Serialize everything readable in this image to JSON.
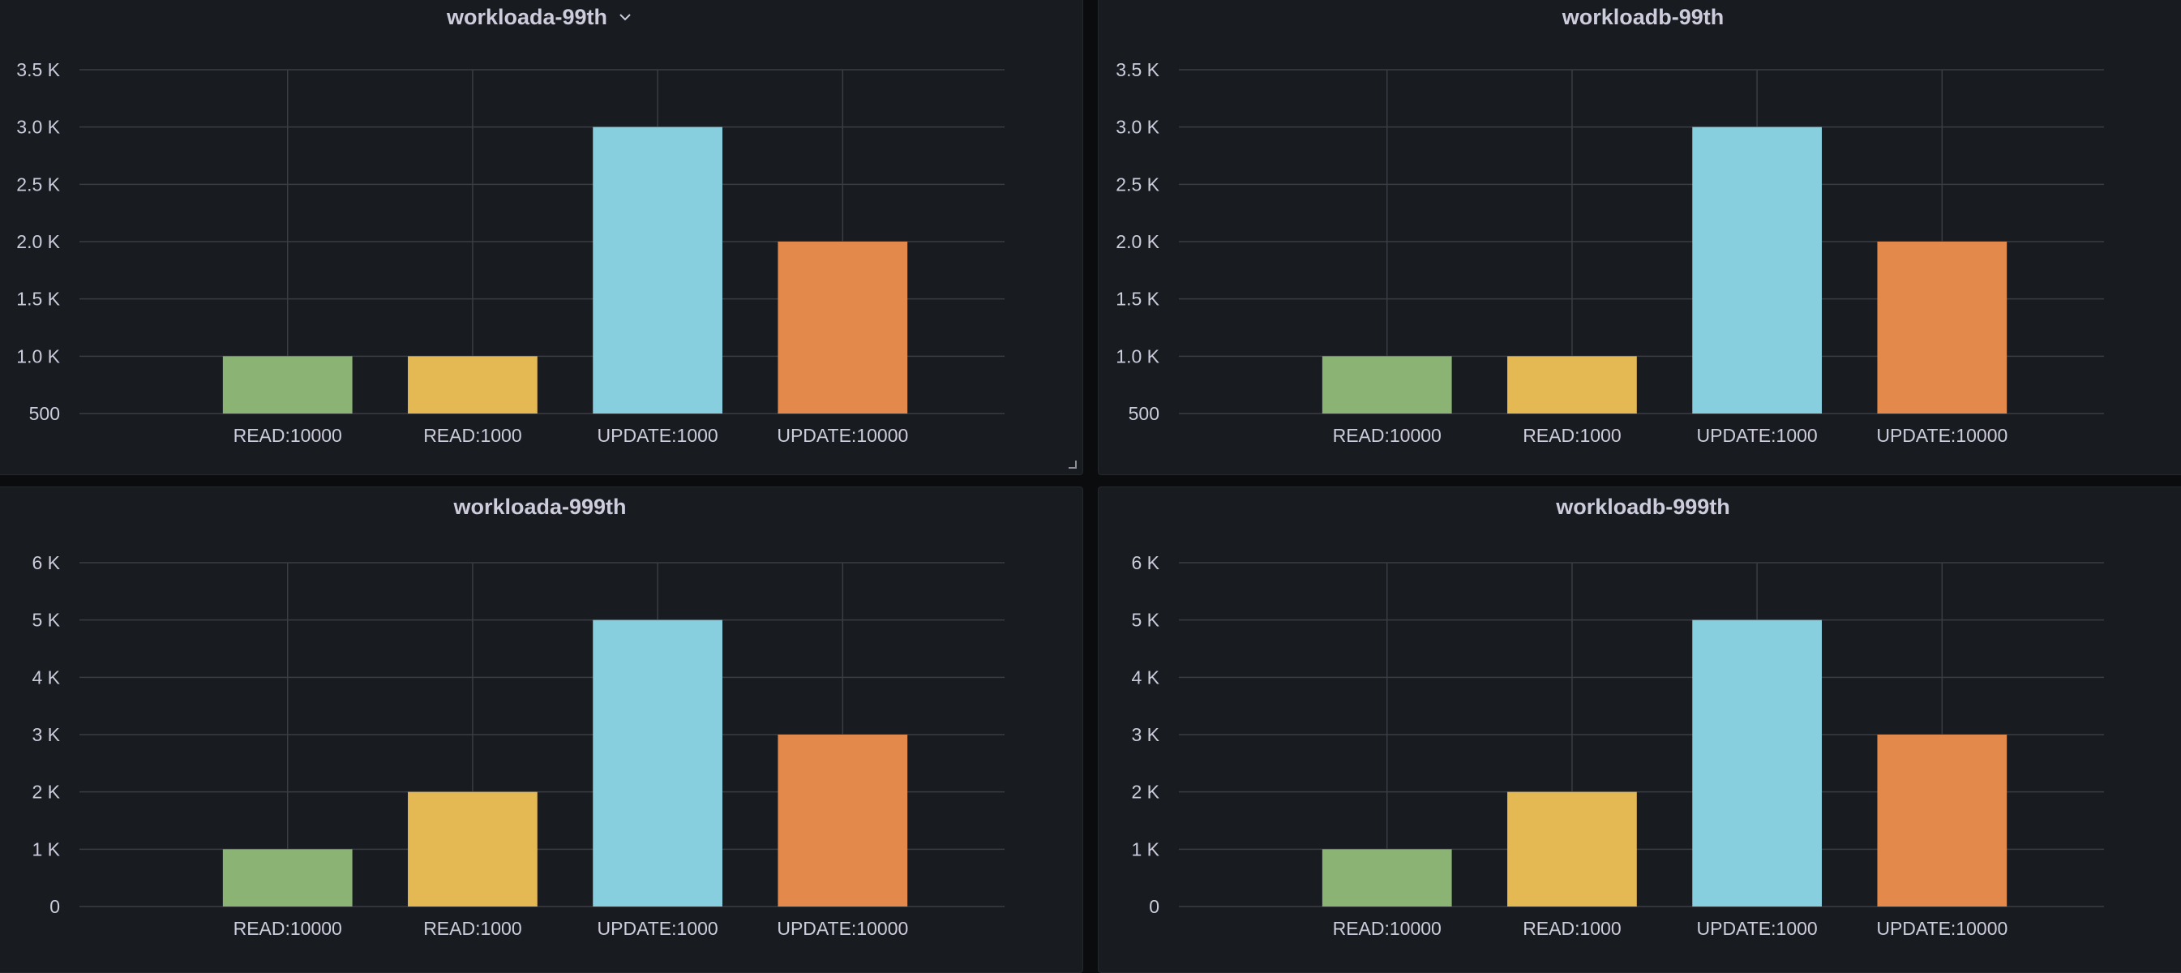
{
  "colors": {
    "background": "#0b0c0e",
    "panel": "#181b1f",
    "grid": "#3a3d44",
    "text": "#ccccdc",
    "bars": [
      "#8ab374",
      "#e4b954",
      "#87cfdf",
      "#e4894c"
    ]
  },
  "chart_data": [
    {
      "type": "bar",
      "title": "workloada-99th",
      "categories": [
        "READ:10000",
        "READ:1000",
        "UPDATE:1000",
        "UPDATE:10000"
      ],
      "values": [
        1000,
        1000,
        3000,
        2000
      ],
      "ylim": [
        500,
        3500
      ],
      "yticks": [
        500,
        1000,
        1500,
        2000,
        2500,
        3000,
        3500
      ],
      "ytick_labels": [
        "500",
        "1.0 K",
        "1.5 K",
        "2.0 K",
        "2.5 K",
        "3.0 K",
        "3.5 K"
      ],
      "grid": true,
      "legend": "none"
    },
    {
      "type": "bar",
      "title": "workloadb-99th",
      "categories": [
        "READ:10000",
        "READ:1000",
        "UPDATE:1000",
        "UPDATE:10000"
      ],
      "values": [
        1000,
        1000,
        3000,
        2000
      ],
      "ylim": [
        500,
        3500
      ],
      "yticks": [
        500,
        1000,
        1500,
        2000,
        2500,
        3000,
        3500
      ],
      "ytick_labels": [
        "500",
        "1.0 K",
        "1.5 K",
        "2.0 K",
        "2.5 K",
        "3.0 K",
        "3.5 K"
      ],
      "grid": true,
      "legend": "none"
    },
    {
      "type": "bar",
      "title": "workloada-999th",
      "categories": [
        "READ:10000",
        "READ:1000",
        "UPDATE:1000",
        "UPDATE:10000"
      ],
      "values": [
        1000,
        2000,
        5000,
        3000
      ],
      "ylim": [
        0,
        6000
      ],
      "yticks": [
        0,
        1000,
        2000,
        3000,
        4000,
        5000,
        6000
      ],
      "ytick_labels": [
        "0",
        "1 K",
        "2 K",
        "3 K",
        "4 K",
        "5 K",
        "6 K"
      ],
      "grid": true,
      "legend": "none"
    },
    {
      "type": "bar",
      "title": "workloadb-999th",
      "categories": [
        "READ:10000",
        "READ:1000",
        "UPDATE:1000",
        "UPDATE:10000"
      ],
      "values": [
        1000,
        2000,
        5000,
        3000
      ],
      "ylim": [
        0,
        6000
      ],
      "yticks": [
        0,
        1000,
        2000,
        3000,
        4000,
        5000,
        6000
      ],
      "ytick_labels": [
        "0",
        "1 K",
        "2 K",
        "3 K",
        "4 K",
        "5 K",
        "6 K"
      ],
      "grid": true,
      "legend": "none"
    }
  ]
}
